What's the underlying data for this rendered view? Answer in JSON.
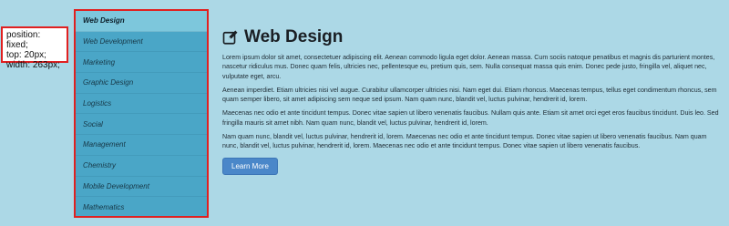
{
  "annotation": {
    "text": "position: fixed;\ntop: 20px;\nwidth: 263px;"
  },
  "sidebar": {
    "items": [
      {
        "label": "Web Design",
        "active": true
      },
      {
        "label": "Web Development",
        "active": false
      },
      {
        "label": "Marketing",
        "active": false
      },
      {
        "label": "Graphic Design",
        "active": false
      },
      {
        "label": "Logistics",
        "active": false
      },
      {
        "label": "Social",
        "active": false
      },
      {
        "label": "Management",
        "active": false
      },
      {
        "label": "Chemistry",
        "active": false
      },
      {
        "label": "Mobile Development",
        "active": false
      },
      {
        "label": "Mathematics",
        "active": false
      }
    ]
  },
  "main": {
    "title_icon": "edit-icon",
    "title": "Web Design",
    "paragraphs": [
      "Lorem ipsum dolor sit amet, consectetuer adipiscing elit. Aenean commodo ligula eget dolor. Aenean massa. Cum sociis natoque penatibus et magnis dis parturient montes, nascetur ridiculus mus. Donec quam felis, ultricies nec, pellentesque eu, pretium quis, sem. Nulla consequat massa quis enim. Donec pede justo, fringilla vel, aliquet nec, vulputate eget, arcu.",
      "Aenean imperdiet. Etiam ultricies nisi vel augue. Curabitur ullamcorper ultricies nisi. Nam eget dui. Etiam rhoncus. Maecenas tempus, tellus eget condimentum rhoncus, sem quam semper libero, sit amet adipiscing sem neque sed ipsum. Nam quam nunc, blandit vel, luctus pulvinar, hendrerit id, lorem.",
      "Maecenas nec odio et ante tincidunt tempus. Donec vitae sapien ut libero venenatis faucibus. Nullam quis ante. Etiam sit amet orci eget eros faucibus tincidunt. Duis leo. Sed fringilla mauris sit amet nibh. Nam quam nunc, blandit vel, luctus pulvinar, hendrerit id, lorem.",
      "Nam quam nunc, blandit vel, luctus pulvinar, hendrerit id, lorem. Maecenas nec odio et ante tincidunt tempus. Donec vitae sapien ut libero venenatis faucibus. Nam quam nunc, blandit vel, luctus pulvinar, hendrerit id, lorem. Maecenas nec odio et ante tincidunt tempus. Donec vitae sapien ut libero venenatis faucibus."
    ],
    "button_label": "Learn More"
  },
  "colors": {
    "page_bg": "#acd8e6",
    "sidebar_bg": "#4aa6c7",
    "sidebar_active_bg": "#7dc7dc",
    "highlight_border": "#e02020",
    "button_bg": "#4a87c9"
  }
}
